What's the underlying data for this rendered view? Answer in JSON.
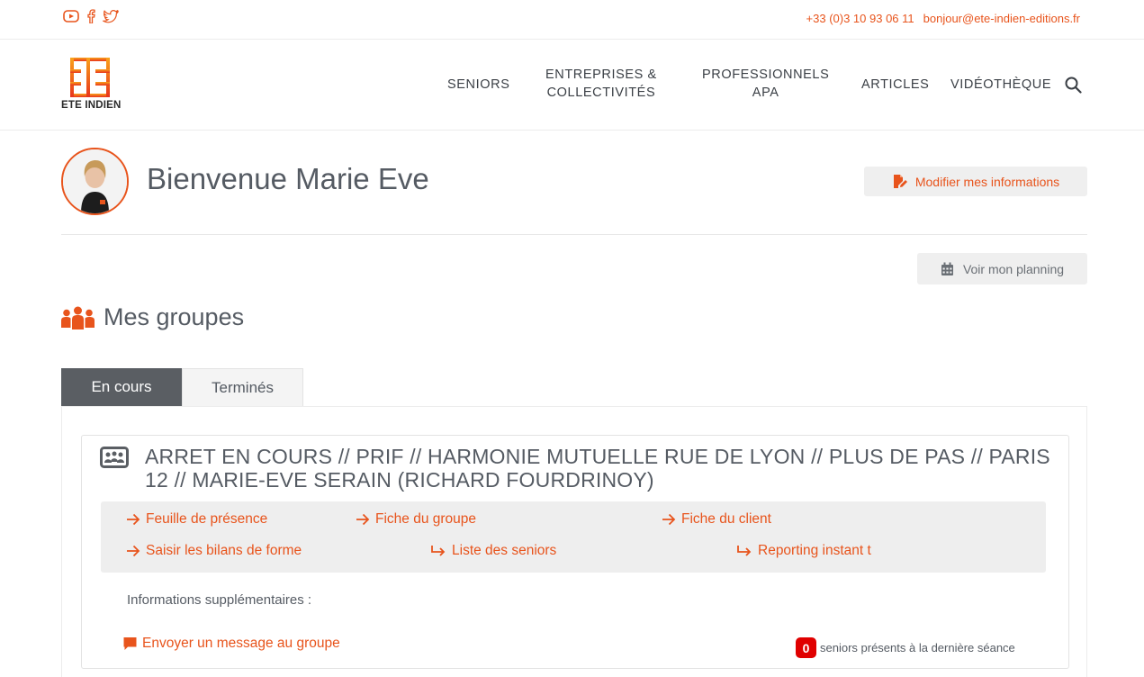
{
  "topbar": {
    "social": [
      {
        "icon": "youtube-icon"
      },
      {
        "icon": "facebook-icon"
      },
      {
        "icon": "twitter-icon"
      }
    ],
    "phone": "+33 (0)3 10 93 06 11",
    "email": "bonjour@ete-indien-editions.fr"
  },
  "header": {
    "logo_text": "ETE INDIEN",
    "nav": [
      {
        "line1": "SENIORS",
        "line2": ""
      },
      {
        "line1": "ENTREPRISES &",
        "line2": "COLLECTIVITÉS"
      },
      {
        "line1": "PROFESSIONNELS",
        "line2": "APA"
      },
      {
        "line1": "ARTICLES",
        "line2": ""
      },
      {
        "line1": "VIDÉOTHÈQUE",
        "line2": ""
      }
    ]
  },
  "welcome": {
    "title": "Bienvenue Marie Eve",
    "modify_label": "Modifier mes informations",
    "planning_label": "Voir mon planning"
  },
  "groups": {
    "title": "Mes groupes",
    "tabs": [
      "En cours",
      "Terminés"
    ],
    "card": {
      "title": "ARRET EN COURS // PRIF // HARMONIE MUTUELLE RUE DE LYON // PLUS DE PAS // PARIS 12 // MARIE-EVE SERAIN (RICHARD FOURDRINOY)",
      "links": [
        "Feuille de présence",
        "Fiche du groupe",
        "Fiche du client",
        "Saisir les bilans de forme",
        "Liste des seniors",
        "Reporting instant t"
      ],
      "info_label": "Informations supplémentaires :",
      "send_message": "Envoyer un message au groupe",
      "seniors_count": "0",
      "seniors_text": "seniors présents à la dernière séance"
    }
  },
  "colors": {
    "accent": "#e8541c",
    "text": "#555b63",
    "badge": "#e00000"
  }
}
